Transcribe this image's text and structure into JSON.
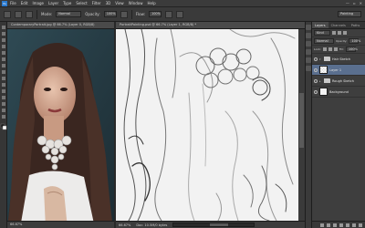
{
  "app": {
    "logo": "Ps",
    "menu": [
      "File",
      "Edit",
      "Image",
      "Layer",
      "Type",
      "Select",
      "Filter",
      "3D",
      "View",
      "Window",
      "Help"
    ],
    "window_controls": [
      "—",
      "▫",
      "✕"
    ]
  },
  "options_bar": {
    "mode_label": "Mode:",
    "mode_value": "Normal",
    "opacity_label": "Opacity:",
    "opacity_value": "100%",
    "flow_label": "Flow:",
    "flow_value": "100%",
    "workspace": "Painting"
  },
  "documents": {
    "photo_tab": "ContemporaryPortrait.jpg @ 66.7% (Layer 0, RGB/8)",
    "photo_status": "66.67%",
    "sketch_tab": "PortraitPainting.psd @ 66.7% (Layer 1, RGB/8) *",
    "zoom": "66.67%",
    "doc_info": "Doc: 10.5M/0 bytes"
  },
  "panel": {
    "tabs": [
      "Layers",
      "Channels",
      "Paths"
    ],
    "kind": "Kind",
    "blend_mode": "Normal",
    "opacity_label": "Opacity:",
    "opacity": "100%",
    "lock_label": "Lock:",
    "fill_label": "Fill:",
    "fill": "100%",
    "layers": [
      {
        "name": "Hair Sketch",
        "type": "group"
      },
      {
        "name": "Layer 1",
        "type": "layer"
      },
      {
        "name": "Rough Sketch",
        "type": "group"
      },
      {
        "name": "Background",
        "type": "layer"
      }
    ]
  },
  "colors": {
    "accent": "#2b7bd0",
    "selected_layer": "#5a6f8f"
  }
}
